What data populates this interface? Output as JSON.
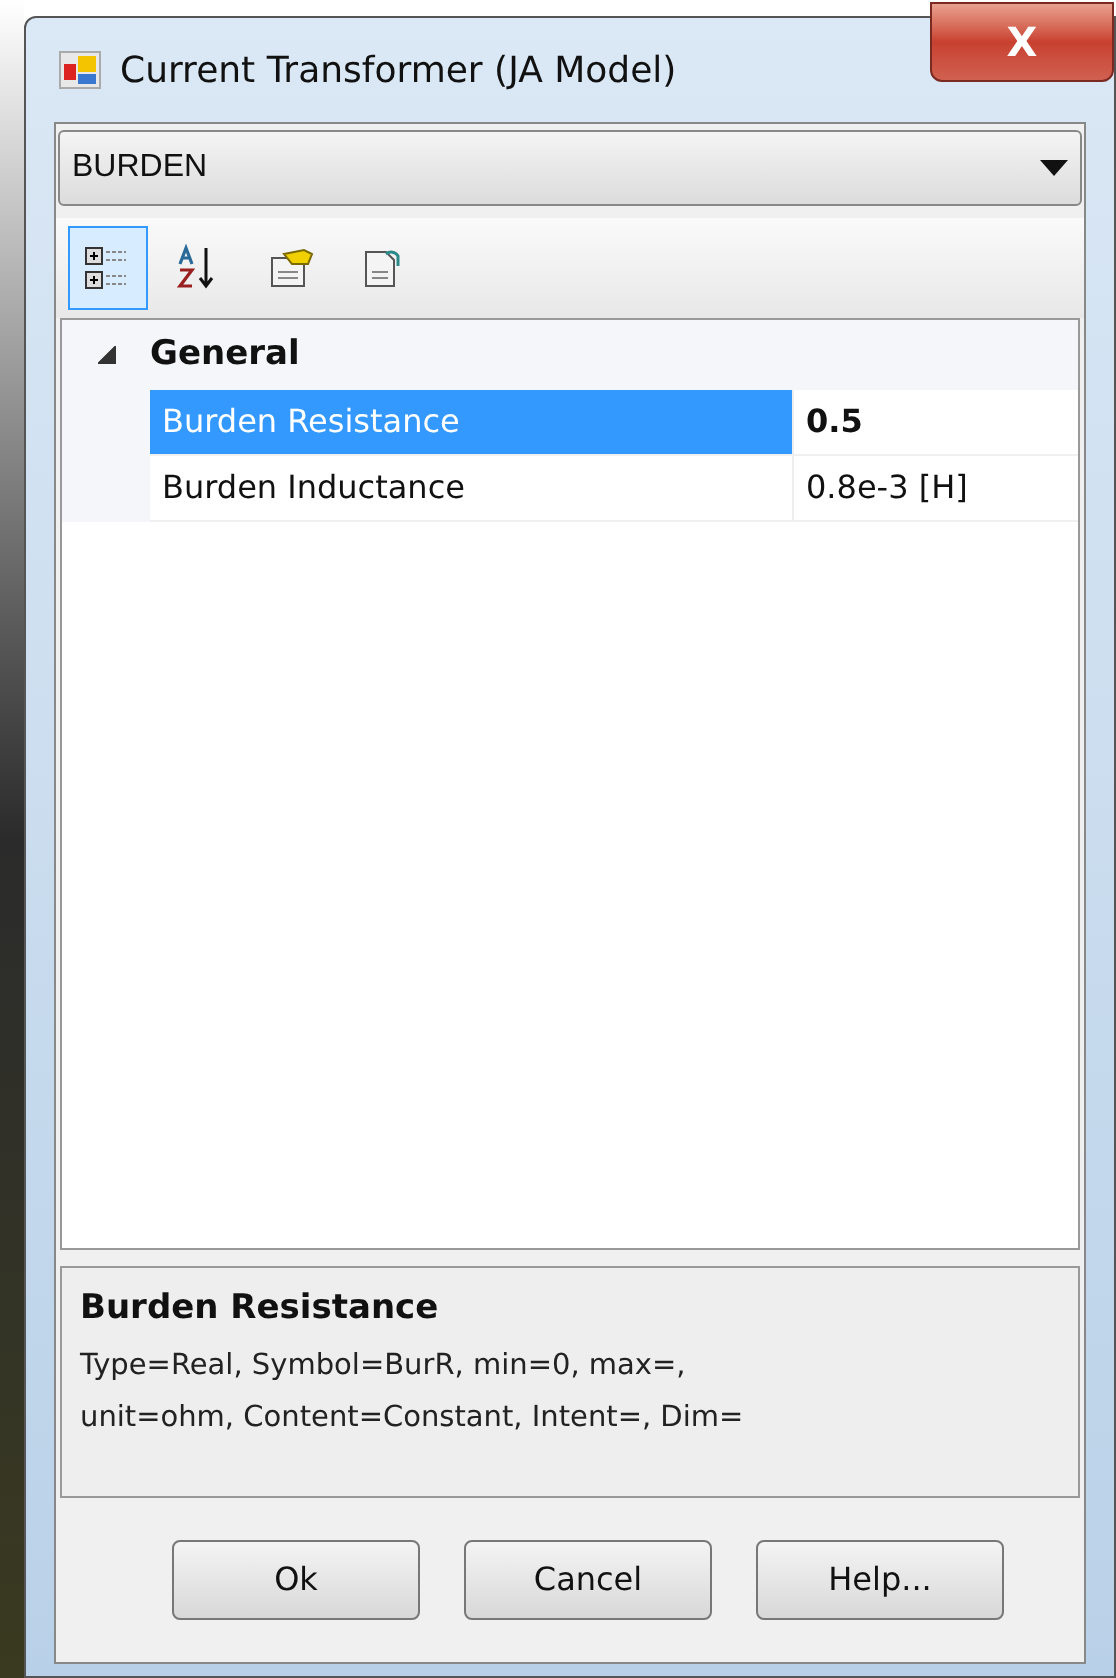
{
  "window": {
    "title": "Current Transformer (JA Model)",
    "close": "X"
  },
  "object_selector": {
    "value": "BURDEN"
  },
  "toolbar": [
    {
      "kind": "categorized",
      "selected": true
    },
    {
      "kind": "alphabetical",
      "selected": false
    },
    {
      "kind": "properties",
      "selected": false
    },
    {
      "kind": "pages",
      "selected": false
    }
  ],
  "categories": [
    {
      "name": "General",
      "expanded": true,
      "properties": [
        {
          "name": "Burden Resistance",
          "value": "0.5",
          "selected": true,
          "modified": true
        },
        {
          "name": "Burden Inductance",
          "value": "0.8e-3 [H]",
          "selected": false,
          "modified": false
        }
      ]
    }
  ],
  "description": {
    "title": "Burden Resistance",
    "text": "Type=Real, Symbol=BurR, min=0, max=, unit=ohm, Content=Constant, Intent=, Dim="
  },
  "buttons": [
    "Ok",
    "Cancel",
    "Help..."
  ]
}
